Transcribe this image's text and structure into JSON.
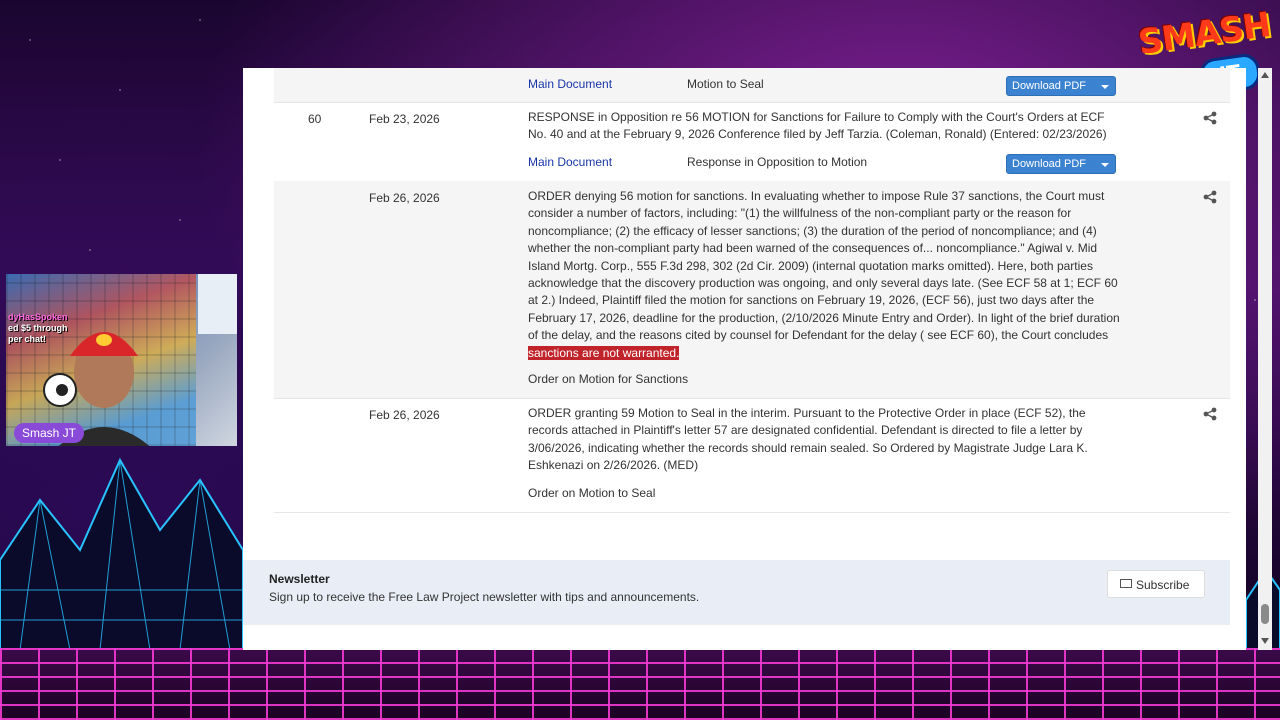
{
  "logo": {
    "top": "SMASH",
    "bottom": "JT"
  },
  "stream": {
    "streamer_name": "Smash JT",
    "overlay_lines": [
      "dyHasSpoken",
      "ed $5 through",
      "per chat!"
    ]
  },
  "docket": {
    "entries": [
      {
        "number": "",
        "date": "",
        "text": "",
        "doc_label": "Main Document",
        "doc_desc": "Motion to Seal",
        "download_label": "Download PDF"
      },
      {
        "number": "60",
        "date": "Feb 23, 2026",
        "text_lines": [
          "RESPONSE in Opposition re 56 MOTION for Sanctions for Failure to Comply with the Court's Orders at ECF",
          "No. 40 and at the February 9, 2026 Conference filed by Jeff Tarzia. (Coleman, Ronald) (Entered: 02/23/2026)"
        ],
        "doc_label": "Main Document",
        "doc_desc": "Response in Opposition to Motion",
        "download_label": "Download PDF"
      },
      {
        "number": "",
        "date": "Feb 26, 2026",
        "text_lines": [
          "ORDER denying 56 motion for sanctions. In evaluating whether to impose Rule 37 sanctions, the Court must",
          "consider a number of factors, including: \"(1) the willfulness of the non-compliant party or the reason for",
          "noncompliance; (2) the efficacy of lesser sanctions; (3) the duration of the period of noncompliance; and (4)",
          "whether the non-compliant party had been warned of the consequences of... noncompliance.\" Agiwal v. Mid",
          "Island Mortg. Corp., 555 F.3d 298, 302 (2d Cir. 2009) (internal quotation marks omitted). Here, both parties",
          "acknowledge that the discovery production was ongoing, and only several days late. (See ECF 58 at 1; ECF 60",
          "at 2.) Indeed, Plaintiff filed the motion for sanctions on February 19, 2026, (ECF 56), just two days after the",
          "February 17, 2026, deadline for the production, (2/10/2026 Minute Entry and Order). In light of the brief duration",
          "of the delay, and the reasons cited by counsel for Defendant for the delay ( see ECF 60), the Court concludes"
        ],
        "highlight": "sanctions are not warranted.",
        "doc_desc": "Order on Motion for Sanctions"
      },
      {
        "number": "",
        "date": "Feb 26, 2026",
        "text_lines": [
          "ORDER granting 59 Motion to Seal in the interim. Pursuant to the Protective Order in place (ECF 52), the",
          "records attached in Plaintiff's letter 57 are designated confidential. Defendant is directed to file a letter by",
          "3/06/2026, indicating whether the records should remain sealed. So Ordered by Magistrate Judge Lara K.",
          "Eshkenazi on 2/26/2026. (MED)"
        ],
        "doc_desc": "Order on Motion to Seal"
      }
    ]
  },
  "newsletter": {
    "title": "Newsletter",
    "subtitle": "Sign up to receive the Free Law Project newsletter with tips and announcements.",
    "button": "Subscribe"
  },
  "colors": {
    "link": "#1a35a8",
    "button": "#3b82d0",
    "highlight": "#c0242a"
  }
}
